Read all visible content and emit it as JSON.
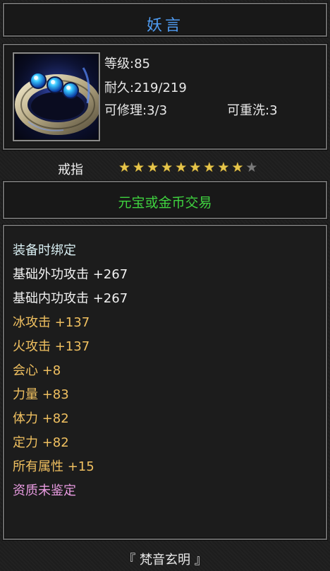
{
  "item": {
    "name": "妖言",
    "icon": "ring-icon",
    "level": "等级:85",
    "durability": "耐久:219/219",
    "repairable": "可修理:3/3",
    "rewashable": "可重洗:3",
    "type": "戒指",
    "stars": {
      "filled": 9,
      "total": 10
    },
    "trade": "元宝或金币交易"
  },
  "attributes": [
    {
      "text": "装备时绑定",
      "color": "#d8eef2"
    },
    {
      "text": "基础外功攻击 +267",
      "color": "#f2f2f2"
    },
    {
      "text": "基础内功攻击 +267",
      "color": "#f2f2f2"
    },
    {
      "text": "冰攻击 +137",
      "color": "#f0c060"
    },
    {
      "text": "火攻击 +137",
      "color": "#f0c060"
    },
    {
      "text": "会心 +8",
      "color": "#f0c060"
    },
    {
      "text": "力量 +83",
      "color": "#f0c060"
    },
    {
      "text": "体力 +82",
      "color": "#f0c060"
    },
    {
      "text": "定力 +82",
      "color": "#f0c060"
    },
    {
      "text": "所有属性 +15",
      "color": "#f0c060"
    },
    {
      "text": "资质未鉴定",
      "color": "#e89ae0"
    }
  ],
  "footer": "『 梵音玄明 』",
  "colors": {
    "title": "#4f9cf2",
    "trade": "#3fd23f",
    "star": "#e6c54a",
    "frame": "#6a6a6a"
  }
}
